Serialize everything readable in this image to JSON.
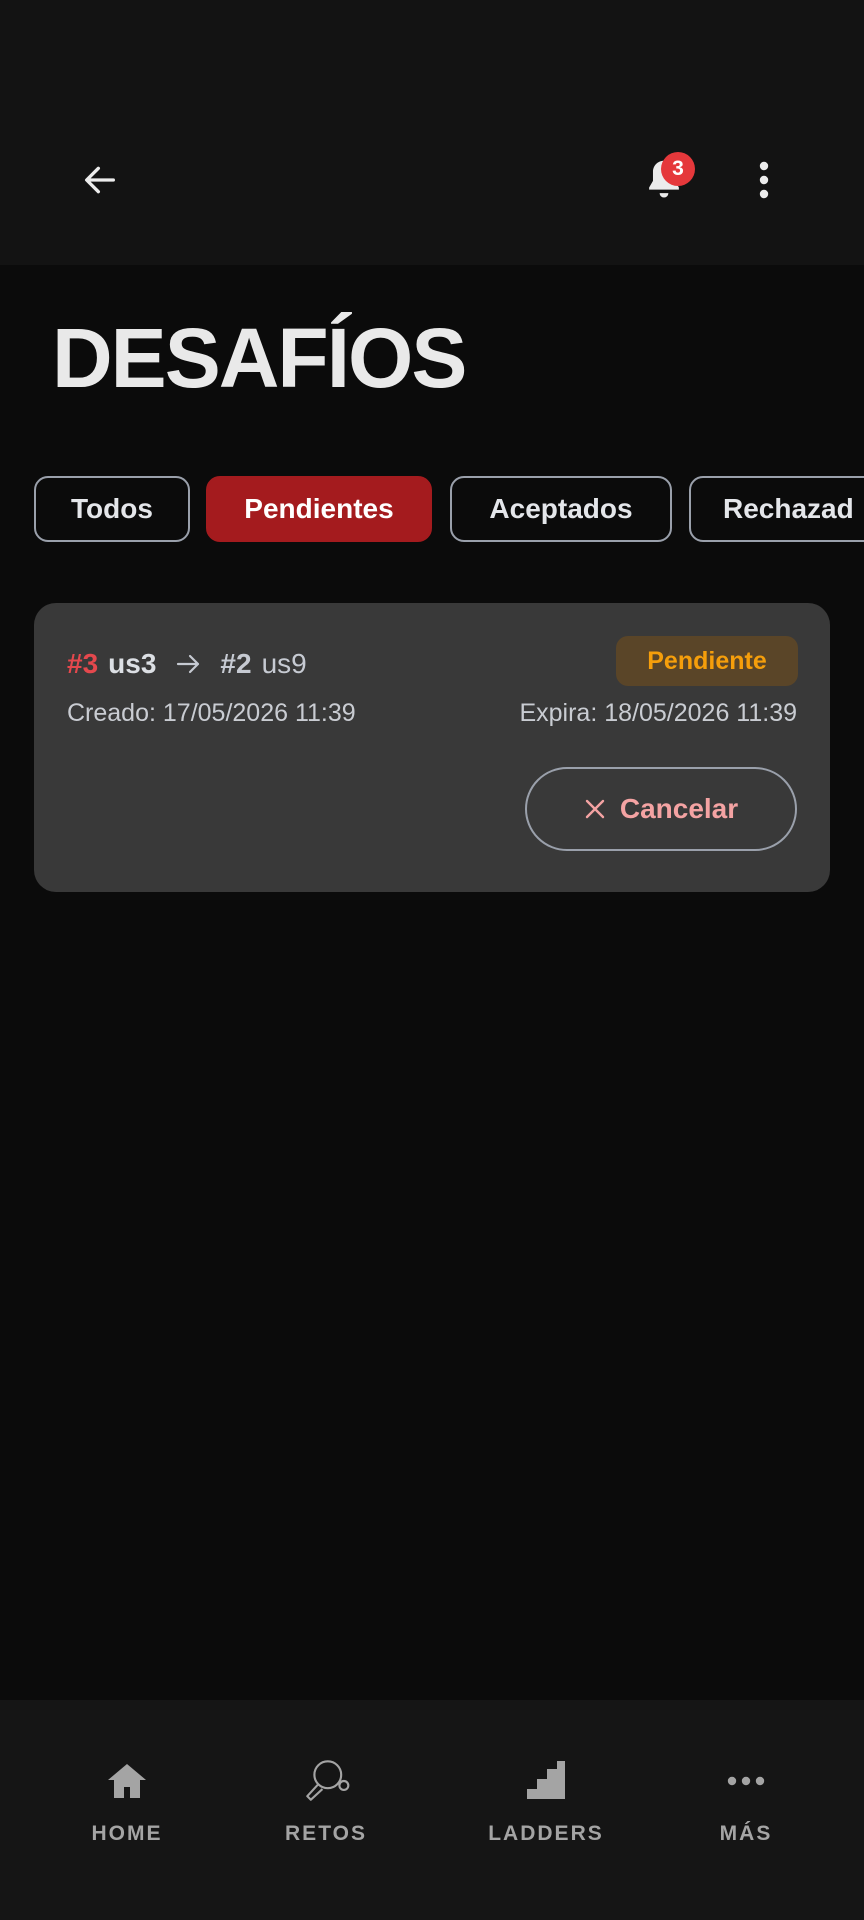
{
  "header": {
    "back_icon": "arrow-left-icon",
    "notification_icon": "bell-icon",
    "notification_count": "3",
    "menu_icon": "more-vertical-icon"
  },
  "page": {
    "title": "DESAFÍOS"
  },
  "filters": {
    "selected": "Pendientes",
    "tabs": [
      {
        "label": "Todos"
      },
      {
        "label": "Pendientes"
      },
      {
        "label": "Aceptados"
      },
      {
        "label": "Rechazad"
      }
    ]
  },
  "challenges": [
    {
      "challenger_rank": "#3",
      "challenger": "us3",
      "challenged_rank": "#2",
      "challenged": "us9",
      "status": "Pendiente",
      "created": "Creado: 17/05/2026 11:39",
      "expires": "Expira: 18/05/2026 11:39",
      "cancel_label": "Cancelar"
    }
  ],
  "bottom_nav": {
    "items": [
      {
        "label": "HOME",
        "icon": "home-icon"
      },
      {
        "label": "RETOS",
        "icon": "ping-pong-icon"
      },
      {
        "label": "LADDERS",
        "icon": "stairs-icon"
      },
      {
        "label": "MÁS",
        "icon": "more-horizontal-icon"
      }
    ]
  },
  "colors": {
    "accent": "#a41b1e",
    "badge": "#e5383b",
    "pending_text": "#f59e0b",
    "pending_bg": "#5a4528",
    "card_bg": "#393939",
    "background": "#0b0b0b"
  }
}
